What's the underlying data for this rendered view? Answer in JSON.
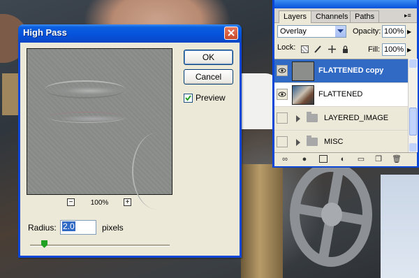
{
  "high_pass": {
    "title": "High Pass",
    "ok_label": "OK",
    "cancel_label": "Cancel",
    "preview_label": "Preview",
    "preview_checked": true,
    "zoom_out": "−",
    "zoom_level": "100%",
    "zoom_in": "+",
    "radius_label": "Radius:",
    "radius_value": "2.0",
    "radius_unit": "pixels",
    "radius_slider_fraction": 0.1
  },
  "layers_panel": {
    "tabs": [
      {
        "label": "Layers",
        "active": true
      },
      {
        "label": "Channels",
        "active": false
      },
      {
        "label": "Paths",
        "active": false
      }
    ],
    "blend_mode": "Overlay",
    "opacity_label": "Opacity:",
    "opacity_value": "100%",
    "lock_label": "Lock:",
    "fill_label": "Fill:",
    "fill_value": "100%",
    "layers": [
      {
        "name": "FLATTENED copy",
        "visible": true,
        "selected": true,
        "type": "layer"
      },
      {
        "name": "FLATTENED",
        "visible": true,
        "selected": false,
        "type": "layer"
      },
      {
        "name": "LAYERED_IMAGE",
        "visible": false,
        "selected": false,
        "type": "group"
      },
      {
        "name": "MISC",
        "visible": false,
        "selected": false,
        "type": "group"
      }
    ],
    "bottom_icons": [
      "link-icon",
      "fx-icon",
      "mask-icon",
      "adjustment-icon",
      "new-group-icon",
      "new-layer-icon",
      "trash-icon"
    ]
  },
  "colors": {
    "titlebar_blue": "#0551da",
    "selection_blue": "#316ac5",
    "dialog_bg": "#ece9d8"
  }
}
